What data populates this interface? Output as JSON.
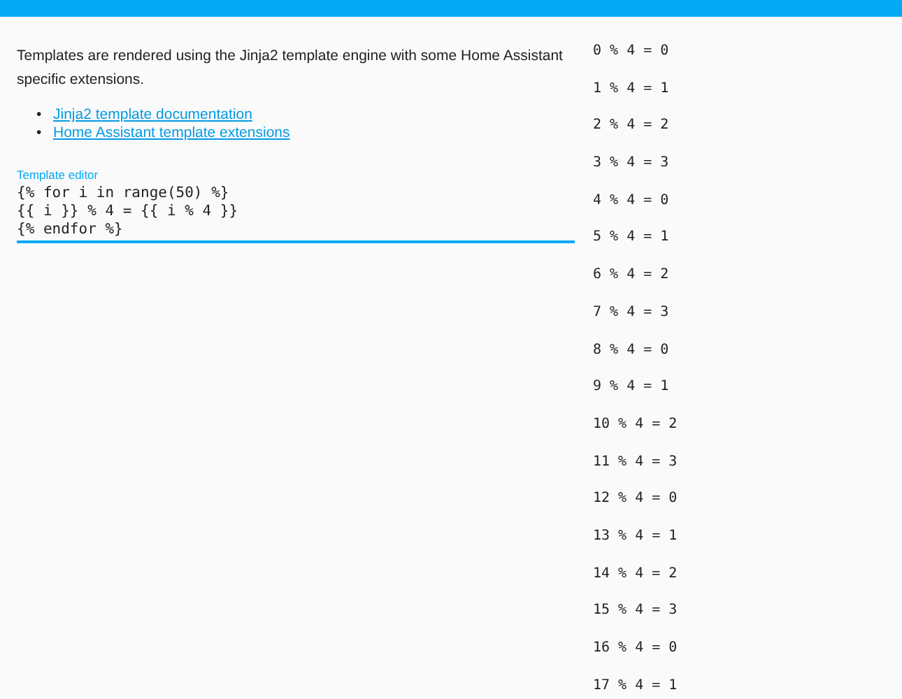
{
  "intro": "Templates are rendered using the Jinja2 template engine with some Home Assistant specific extensions.",
  "links": [
    {
      "bullet": "•",
      "text": "Jinja2 template documentation"
    },
    {
      "bullet": "•",
      "text": "Home Assistant template extensions"
    }
  ],
  "editor": {
    "label": "Template editor",
    "lines": [
      "{% for i in range(50) %}",
      "{{ i }} % 4 = {{ i % 4 }}",
      "{% endfor %}"
    ],
    "focused": true
  },
  "results": [
    "0 % 4 = 0",
    "1 % 4 = 1",
    "2 % 4 = 2",
    "3 % 4 = 3",
    "4 % 4 = 0",
    "5 % 4 = 1",
    "6 % 4 = 2",
    "7 % 4 = 3",
    "8 % 4 = 0",
    "9 % 4 = 1",
    "10 % 4 = 2",
    "11 % 4 = 3",
    "12 % 4 = 0",
    "13 % 4 = 1",
    "14 % 4 = 2",
    "15 % 4 = 3",
    "16 % 4 = 0",
    "17 % 4 = 1"
  ]
}
